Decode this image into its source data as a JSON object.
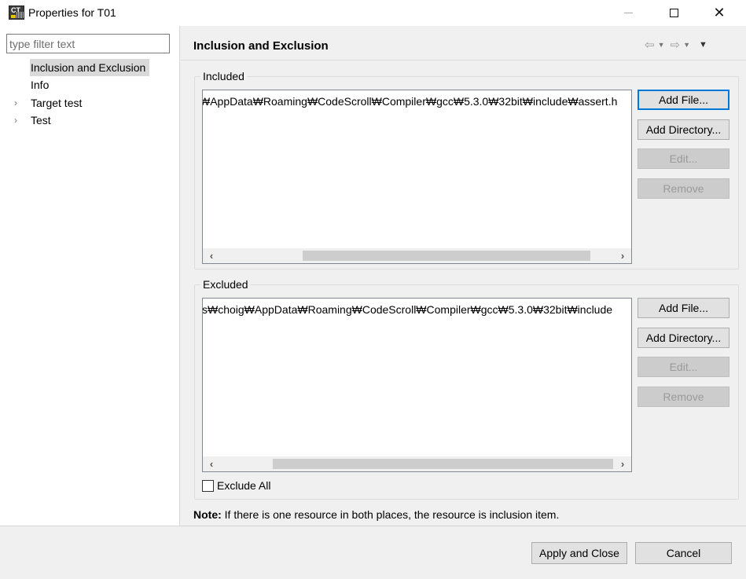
{
  "window": {
    "title": "Properties for T01"
  },
  "filter": {
    "placeholder": "type filter text",
    "value": ""
  },
  "tree": {
    "items": [
      {
        "label": "Inclusion and Exclusion",
        "selected": true,
        "expandable": false
      },
      {
        "label": "Info",
        "selected": false,
        "expandable": false
      },
      {
        "label": "Target test",
        "selected": false,
        "expandable": true
      },
      {
        "label": "Test",
        "selected": false,
        "expandable": true
      }
    ]
  },
  "page": {
    "title": "Inclusion and Exclusion"
  },
  "included": {
    "label": "Included",
    "items": [
      "₩AppData₩Roaming₩CodeScroll₩Compiler₩gcc₩5.3.0₩32bit₩include₩assert.h"
    ],
    "buttons": {
      "add_file": "Add File...",
      "add_directory": "Add Directory...",
      "edit": "Edit...",
      "remove": "Remove"
    }
  },
  "excluded": {
    "label": "Excluded",
    "items": [
      "s₩choig₩AppData₩Roaming₩CodeScroll₩Compiler₩gcc₩5.3.0₩32bit₩include"
    ],
    "buttons": {
      "add_file": "Add File...",
      "add_directory": "Add Directory...",
      "edit": "Edit...",
      "remove": "Remove"
    },
    "exclude_all_label": "Exclude All",
    "exclude_all_checked": false
  },
  "note": {
    "prefix": "Note:",
    "text": "If there is one resource in both places, the resource is inclusion item."
  },
  "footer": {
    "apply_close": "Apply and Close",
    "cancel": "Cancel"
  },
  "icons": [
    "app-icon",
    "minimize-icon",
    "maximize-icon",
    "close-icon",
    "chevron-right-icon",
    "back-arrow-icon",
    "forward-arrow-icon",
    "dropdown-icon",
    "view-menu-icon",
    "scroll-left-icon",
    "scroll-right-icon"
  ]
}
